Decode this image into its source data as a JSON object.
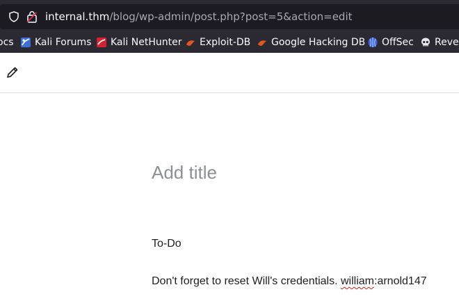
{
  "browser": {
    "url_host": "internal.thm",
    "url_path": "/blog/wp-admin/post.php?post=5&action=edit",
    "bookmarks": [
      {
        "label": "ocs",
        "icon": "docs-icon"
      },
      {
        "label": "Kali Forums",
        "icon": "kali-forums-icon"
      },
      {
        "label": "Kali NetHunter",
        "icon": "kali-nethunter-icon"
      },
      {
        "label": "Exploit-DB",
        "icon": "exploit-db-icon"
      },
      {
        "label": "Google Hacking DB",
        "icon": "google-hacking-db-icon"
      },
      {
        "label": "OffSec",
        "icon": "offsec-icon"
      },
      {
        "label": "Rever",
        "icon": "skull-icon"
      }
    ]
  },
  "editor": {
    "title_placeholder": "Add title",
    "blocks": {
      "todo": "To-Do",
      "note_prefix": "Don't forget to reset Will's credentials. ",
      "note_misspelled": "william",
      "note_suffix": ":arnold147"
    }
  },
  "colors": {
    "chrome": "#2b2a33",
    "urlbar": "#1c1b22",
    "title_placeholder": "#8c8f94",
    "body_text": "#1e1e1e"
  }
}
